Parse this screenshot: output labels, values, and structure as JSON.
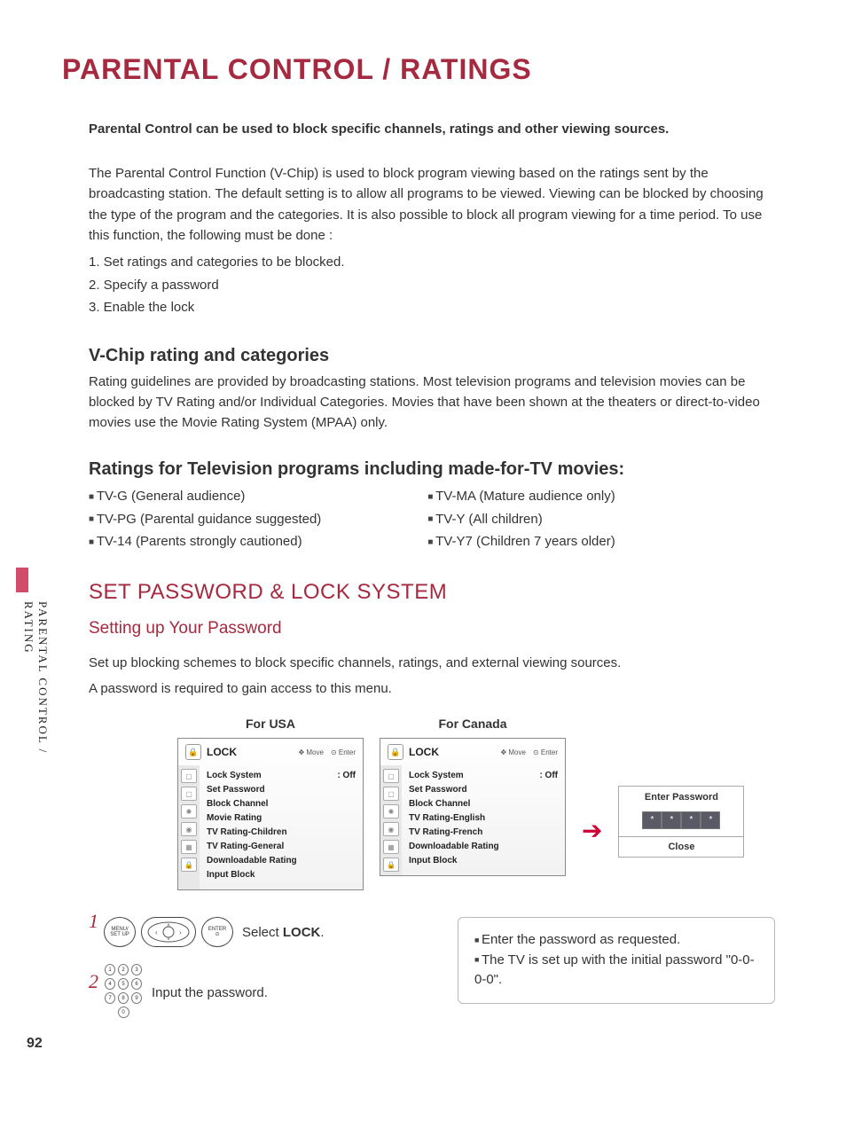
{
  "page_number": "92",
  "side_tab": "PARENTAL CONTROL / RATING",
  "title": "PARENTAL CONTROL / RATINGS",
  "intro_bold": "Parental Control can be used to block specific channels, ratings and other viewing sources.",
  "intro_para": "The Parental Control Function (V-Chip) is used to block program viewing based on the ratings sent by the broadcasting station. The default setting is to allow all programs to be viewed. Viewing can be blocked by choosing the type of the program and the categories. It is also possible to block all program viewing for a time period. To use this function, the following must be done :",
  "steps": [
    "1. Set ratings and categories to be blocked.",
    "2. Specify a password",
    "3. Enable the lock"
  ],
  "vchip": {
    "heading": "V-Chip rating and categories",
    "body": "Rating guidelines are provided by broadcasting stations. Most television programs and television movies can be blocked by TV Rating and/or Individual Categories. Movies that have been shown at the theaters or direct-to-video movies use the Movie Rating System (MPAA) only."
  },
  "ratings": {
    "heading": "Ratings for Television programs including made-for-TV movies:",
    "left": [
      "TV-G   (General audience)",
      "TV-PG (Parental guidance suggested)",
      "TV-14  (Parents strongly cautioned)"
    ],
    "right": [
      "TV-MA (Mature audience only)",
      "TV-Y    (All children)",
      "TV-Y7  (Children 7 years older)"
    ]
  },
  "setpw": {
    "heading": "SET PASSWORD & LOCK SYSTEM",
    "sub": "Setting up Your Password",
    "p1": "Set up blocking schemes to block specific channels, ratings, and external viewing sources.",
    "p2": "A password is required to gain access to this menu."
  },
  "menus": {
    "usa_label": "For USA",
    "canada_label": "For Canada",
    "header_title": "LOCK",
    "header_move": "Move",
    "header_enter": "Enter",
    "usa_items": [
      {
        "label": "Lock System",
        "value": ": Off"
      },
      {
        "label": "Set Password",
        "value": ""
      },
      {
        "label": "Block Channel",
        "value": ""
      },
      {
        "label": "Movie Rating",
        "value": ""
      },
      {
        "label": "TV Rating-Children",
        "value": ""
      },
      {
        "label": "TV Rating-General",
        "value": ""
      },
      {
        "label": "Downloadable Rating",
        "value": ""
      },
      {
        "label": "Input Block",
        "value": ""
      }
    ],
    "canada_items": [
      {
        "label": "Lock System",
        "value": ": Off"
      },
      {
        "label": "Set Password",
        "value": ""
      },
      {
        "label": "Block Channel",
        "value": ""
      },
      {
        "label": "TV Rating-English",
        "value": ""
      },
      {
        "label": "TV Rating-French",
        "value": ""
      },
      {
        "label": "Downloadable Rating",
        "value": ""
      },
      {
        "label": "Input Block",
        "value": ""
      }
    ]
  },
  "pw_popup": {
    "title": "Enter Password",
    "digit": "*",
    "close": "Close"
  },
  "procedure": {
    "step1_btn1": "MENU/\nSET UP",
    "step1_btn3": "ENTER\n⊙",
    "step1_text_a": "Select ",
    "step1_text_b": "LOCK",
    "step1_text_c": ".",
    "step2_text": "Input the password."
  },
  "infobox": {
    "line1": "Enter the password as requested.",
    "line2": "The TV is set up with the initial password \"0-0-0-0\"."
  }
}
